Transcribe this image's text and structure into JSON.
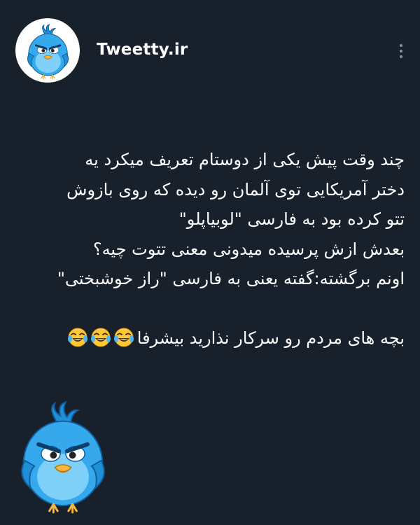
{
  "header": {
    "account_name": "Tweetty.ir",
    "avatar_icon": "angry-blue-bird-icon",
    "menu_icon": "more-vertical-icon"
  },
  "post": {
    "lines": [
      "چند وقت پیش یکی از دوستام تعریف میکرد یه",
      "دختر آمریکایی توی آلمان رو دیده که روی بازوش",
      "تتو کرده بود به فارسی \"لوبیاپلو\"",
      "بعدش ازش پرسیده میدونی معنی تتوت چیه؟",
      "اونم برگشته:گفته یعنی به فارسی \"راز خوشبختی\"",
      "",
      "بچه های مردم رو سرکار نذارید بیشرفا"
    ],
    "trailing_emoji": [
      "face-with-tears-of-joy",
      "face-with-tears-of-joy",
      "face-with-tears-of-joy"
    ]
  },
  "colors": {
    "background": "#18202b",
    "text": "#ffffff",
    "bird_blue": "#35a9ec",
    "menu_dots": "#8a939e"
  },
  "decor": {
    "mascot_icon": "angry-blue-bird-icon"
  }
}
